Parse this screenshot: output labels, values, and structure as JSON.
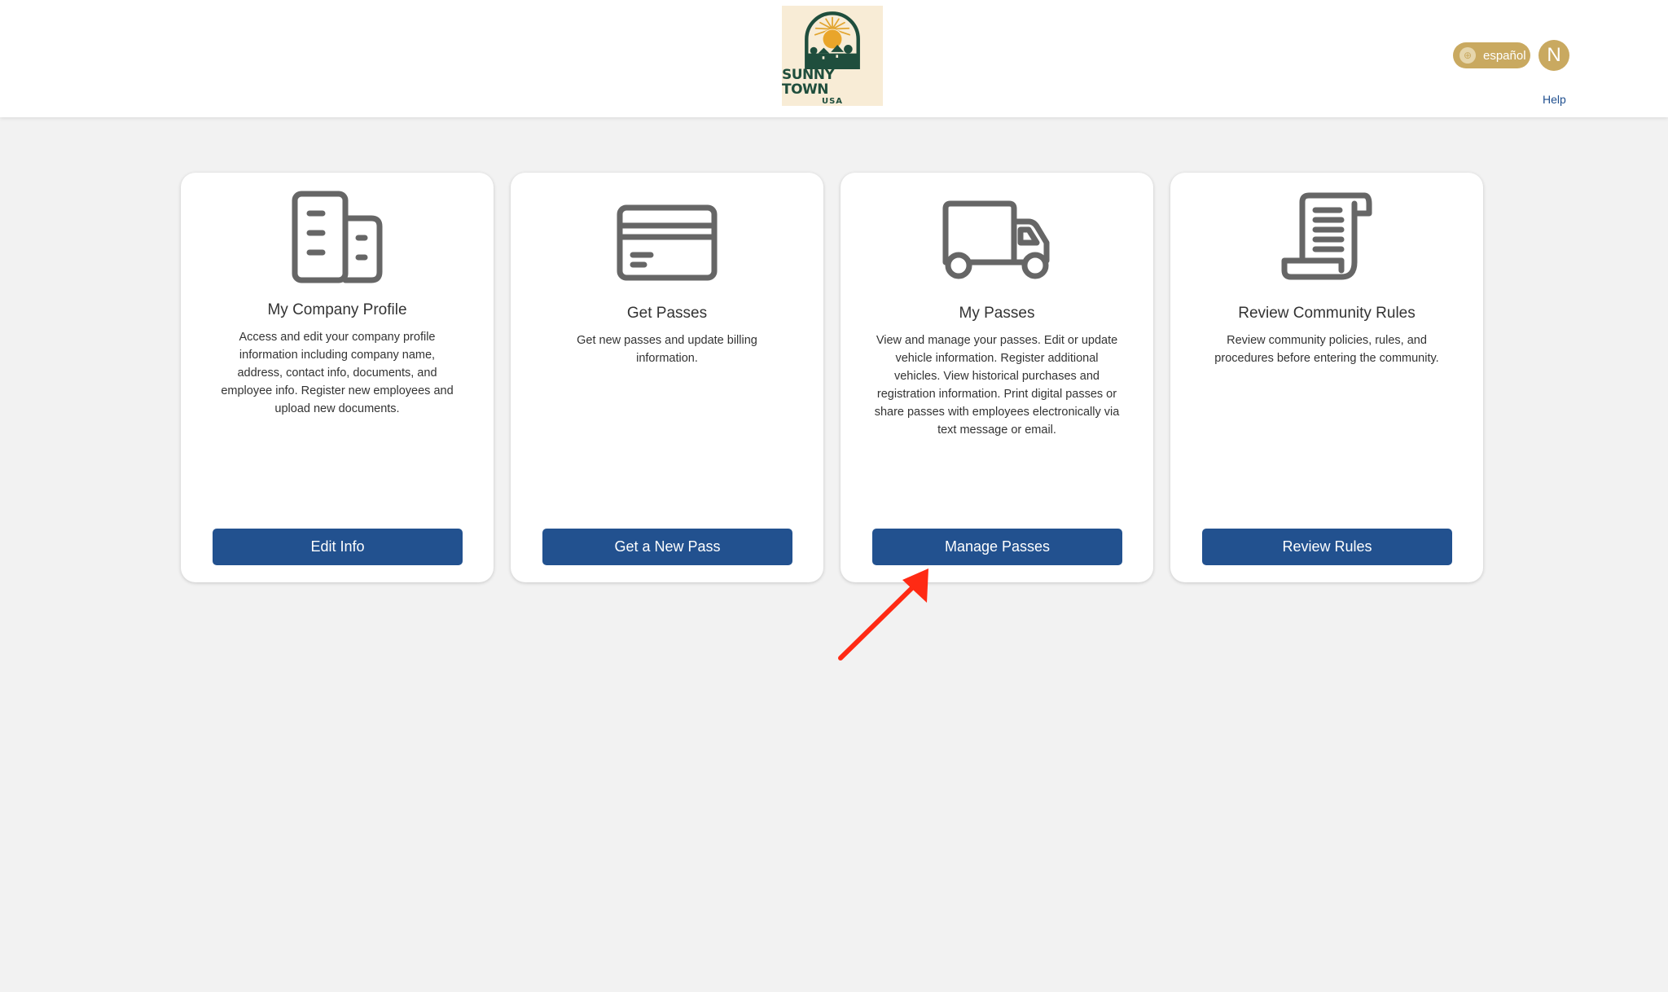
{
  "header": {
    "logo": {
      "title": "SUNNY TOWN",
      "subtitle": "USA"
    },
    "language_toggle_label": "español",
    "avatar_initial": "N",
    "help_label": "Help"
  },
  "cards": [
    {
      "icon": "building-icon",
      "title": "My Company Profile",
      "description": "Access and edit your company profile information including company name, address, contact info, documents, and employee info. Register new employees and upload new documents.",
      "button_label": "Edit Info"
    },
    {
      "icon": "credit-card-icon",
      "title": "Get Passes",
      "description": "Get new passes and update billing information.",
      "button_label": "Get a New Pass"
    },
    {
      "icon": "truck-icon",
      "title": "My Passes",
      "description": "View and manage your passes. Edit or update vehicle information. Register additional vehicles. View historical purchases and registration information. Print digital passes or share passes with employees electronically via text message or email.",
      "button_label": "Manage Passes"
    },
    {
      "icon": "scroll-icon",
      "title": "Review Community Rules",
      "description": "Review community policies, rules, and procedures before entering the community.",
      "button_label": "Review Rules"
    }
  ],
  "annotation": {
    "type": "red-arrow",
    "target": "Manage Passes"
  },
  "colors": {
    "primary_button": "#22518f",
    "accent_gold": "#c9a960",
    "icon_gray": "#666666",
    "page_background": "#f2f2f2",
    "annotation_red": "#ff2a14"
  }
}
